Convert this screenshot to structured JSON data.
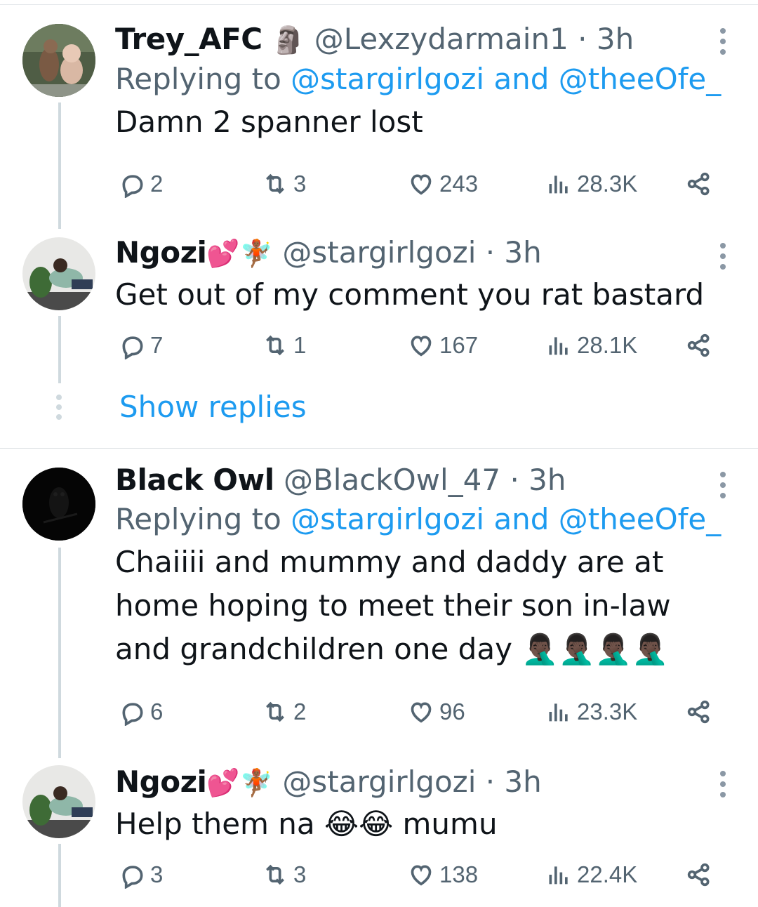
{
  "tweets": [
    {
      "name": "Trey_AFC",
      "name_emoji": "🗿",
      "handle": "@Lexzydarmain1 · 3h",
      "replying_prefix": "Replying to ",
      "replying_mentions": "@stargirlgozi and @theeOfe_",
      "text": "Damn 2 spanner lost",
      "stats": {
        "replies": "2",
        "retweets": "3",
        "likes": "243",
        "views": "28.3K"
      }
    },
    {
      "name": "Ngozi",
      "name_emoji": "💕🧚🏾",
      "handle": "@stargirlgozi · 3h",
      "text": "Get out of my comment you rat bastard",
      "stats": {
        "replies": "7",
        "retweets": "1",
        "likes": "167",
        "views": "28.1K"
      }
    },
    {
      "name": "Black Owl",
      "name_emoji": "",
      "handle": "@BlackOwl_47 · 3h",
      "replying_prefix": "Replying to ",
      "replying_mentions": "@stargirlgozi and @theeOfe_",
      "text": "Chaiiii and mummy and daddy are at home hoping to meet their son in-law and grandchildren one day 🤦🏿‍♂️🤦🏿‍♂️🤦🏿‍♂️🤦🏿‍♂️",
      "stats": {
        "replies": "6",
        "retweets": "2",
        "likes": "96",
        "views": "23.3K"
      }
    },
    {
      "name": "Ngozi",
      "name_emoji": "💕🧚🏾",
      "handle": "@stargirlgozi · 3h",
      "text": "Help them na 😂😂 mumu",
      "stats": {
        "replies": "3",
        "retweets": "3",
        "likes": "138",
        "views": "22.4K"
      }
    }
  ],
  "show_replies": "Show replies",
  "colors": {
    "accent": "#1d9bf0",
    "secondary_text": "#536471",
    "thread_line": "#cfd9de"
  }
}
